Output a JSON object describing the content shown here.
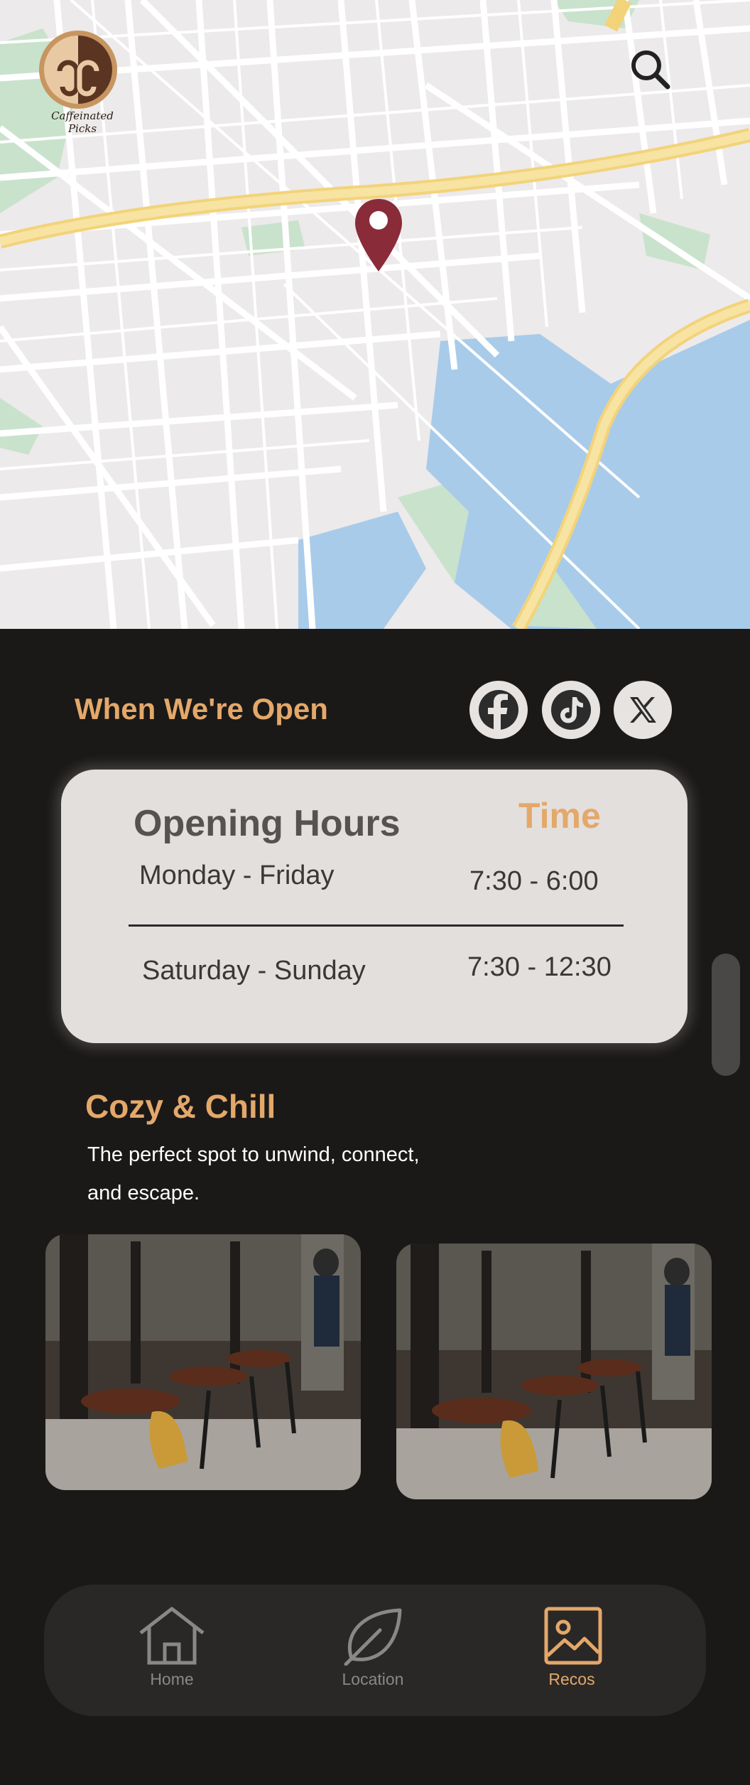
{
  "app": {
    "brand_name": "Caffeinated Picks"
  },
  "header": {
    "search_icon": "search-icon"
  },
  "map": {
    "pin_icon": "map-pin-icon"
  },
  "hours_section": {
    "title": "When We're Open",
    "socials": [
      {
        "name": "Facebook",
        "icon": "facebook-icon"
      },
      {
        "name": "TikTok",
        "icon": "tiktok-icon"
      },
      {
        "name": "X",
        "icon": "x-icon"
      }
    ],
    "table": {
      "heading": "Opening Hours",
      "time_heading": "Time",
      "rows": [
        {
          "days": "Monday - Friday",
          "time": "7:30 - 6:00"
        },
        {
          "days": "Saturday - Sunday",
          "time": "7:30 - 12:30"
        }
      ]
    }
  },
  "cozy_section": {
    "title": "Cozy & Chill",
    "tagline": "The perfect spot to unwind, connect, and escape."
  },
  "bottom_nav": {
    "items": [
      {
        "label": "Home",
        "icon": "home-icon",
        "active": false
      },
      {
        "label": "Location",
        "icon": "leaf-icon",
        "active": false
      },
      {
        "label": "Recos",
        "icon": "image-icon",
        "active": true
      }
    ]
  },
  "colors": {
    "accent": "#e3a86a",
    "background": "#1b1918",
    "card": "#e3dfdd",
    "pin": "#8a2b3a",
    "nav_inactive": "#8a8886"
  }
}
